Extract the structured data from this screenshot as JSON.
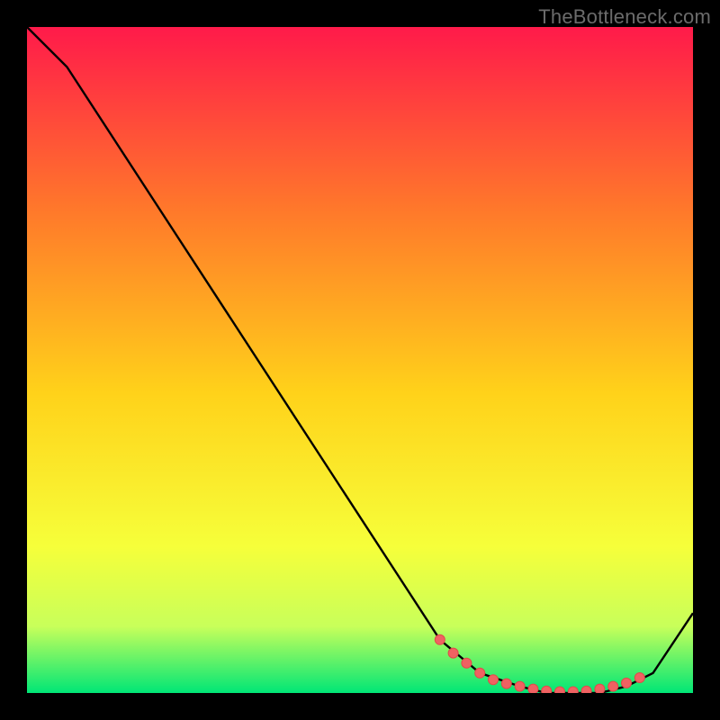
{
  "watermark": "TheBottleneck.com",
  "colors": {
    "bg": "#000000",
    "grad_top": "#ff1a4a",
    "grad_mid1": "#ff7a2a",
    "grad_mid2": "#ffd21a",
    "grad_mid3": "#f6ff3a",
    "grad_mid4": "#c8ff5a",
    "grad_bottom": "#00e676",
    "curve": "#000000",
    "marker_fill": "#ef6262",
    "marker_stroke": "#e24a4a"
  },
  "chart_data": {
    "type": "line",
    "title": "",
    "xlabel": "",
    "ylabel": "",
    "xlim": [
      0,
      100
    ],
    "ylim": [
      0,
      100
    ],
    "series": [
      {
        "name": "curve",
        "x": [
          0,
          6,
          62,
          68,
          74,
          78,
          82,
          86,
          90,
          94,
          100
        ],
        "y": [
          100,
          94,
          8,
          3,
          1,
          0,
          0,
          0,
          1,
          3,
          12
        ]
      }
    ],
    "markers": {
      "name": "highlight-dots",
      "x": [
        62,
        64,
        66,
        68,
        70,
        72,
        74,
        76,
        78,
        80,
        82,
        84,
        86,
        88,
        90,
        92
      ],
      "y": [
        8,
        6,
        4.5,
        3,
        2,
        1.4,
        1,
        0.6,
        0.3,
        0.2,
        0.2,
        0.3,
        0.6,
        1,
        1.5,
        2.3
      ]
    }
  }
}
